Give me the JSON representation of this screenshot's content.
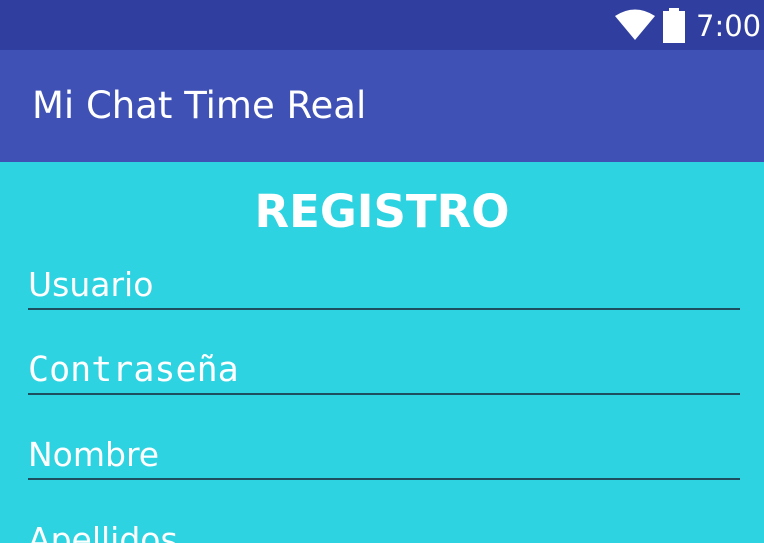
{
  "status_bar": {
    "time": "7:00",
    "icons": [
      "wifi-icon",
      "battery-icon"
    ],
    "background": "#303F9F"
  },
  "app_bar": {
    "title": "Mi Chat Time Real",
    "background": "#3F51B5"
  },
  "form": {
    "title": "REGISTRO",
    "background": "#2DD3E0",
    "fields": [
      {
        "hint": "Usuario"
      },
      {
        "hint": "Contraseña"
      },
      {
        "hint": "Nombre"
      },
      {
        "hint": "Apellidos"
      }
    ]
  }
}
